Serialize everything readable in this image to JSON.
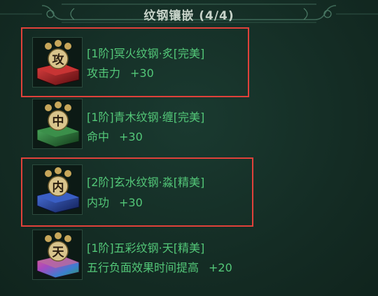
{
  "panel": {
    "title": "纹钢镶嵌 (4/4)"
  },
  "items": [
    {
      "glyph": "攻",
      "name": "[1阶]冥火纹钢·炙[完美]",
      "stat": "攻击力",
      "value": "+30",
      "gem": "#b8262a",
      "highlighted": true
    },
    {
      "glyph": "中",
      "name": "[1阶]青木纹钢·缠[完美]",
      "stat": "命中",
      "value": "+30",
      "gem": "#2e7a3a",
      "highlighted": false
    },
    {
      "glyph": "内",
      "name": "[2阶]玄水纹钢·淼[精美]",
      "stat": "内功",
      "value": "+30",
      "gem": "#2a4fb0",
      "highlighted": true
    },
    {
      "glyph": "天",
      "name": "[1阶]五彩纹钢·天[精美]",
      "stat": "五行负面效果时间提高",
      "value": "+20",
      "gem": "#8a4aa8",
      "highlighted": false
    }
  ],
  "colors": {
    "text_green": "#53c778",
    "highlight_border": "#e0413a",
    "background": "#142c24"
  }
}
